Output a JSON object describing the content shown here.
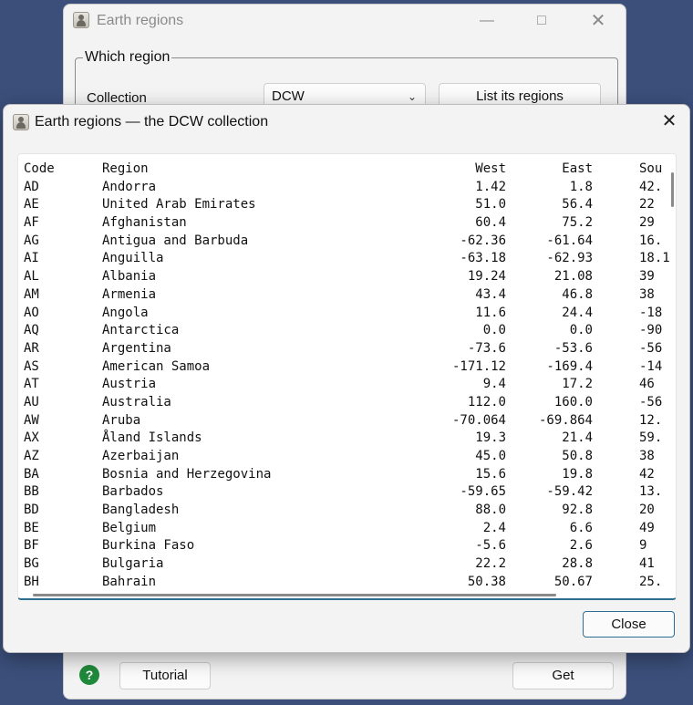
{
  "background_window": {
    "title": "Earth regions",
    "group_title": "Which region",
    "collection_label": "Collection",
    "collection_value": "DCW",
    "list_button": "List its regions",
    "help_icon": "?",
    "tutorial_button": "Tutorial",
    "get_button": "Get"
  },
  "dialog": {
    "title": "Earth regions — the DCW collection",
    "close_button": "Close",
    "columns": {
      "code": "Code",
      "region": "Region",
      "west": "West",
      "east": "East",
      "south": "Sou"
    },
    "rows": [
      {
        "code": "AD",
        "region": "Andorra",
        "west": "1.42",
        "east": "1.8",
        "south": "42."
      },
      {
        "code": "AE",
        "region": "United Arab Emirates",
        "west": "51.0",
        "east": "56.4",
        "south": "22"
      },
      {
        "code": "AF",
        "region": "Afghanistan",
        "west": "60.4",
        "east": "75.2",
        "south": "29"
      },
      {
        "code": "AG",
        "region": "Antigua and Barbuda",
        "west": "-62.36",
        "east": "-61.64",
        "south": "16."
      },
      {
        "code": "AI",
        "region": "Anguilla",
        "west": "-63.18",
        "east": "-62.93",
        "south": "18.1"
      },
      {
        "code": "AL",
        "region": "Albania",
        "west": "19.24",
        "east": "21.08",
        "south": "39"
      },
      {
        "code": "AM",
        "region": "Armenia",
        "west": "43.4",
        "east": "46.8",
        "south": "38"
      },
      {
        "code": "AO",
        "region": "Angola",
        "west": "11.6",
        "east": "24.4",
        "south": "-18"
      },
      {
        "code": "AQ",
        "region": "Antarctica",
        "west": "0.0",
        "east": "0.0",
        "south": "-90"
      },
      {
        "code": "AR",
        "region": "Argentina",
        "west": "-73.6",
        "east": "-53.6",
        "south": "-56"
      },
      {
        "code": "AS",
        "region": "American Samoa",
        "west": "-171.12",
        "east": "-169.4",
        "south": "-14"
      },
      {
        "code": "AT",
        "region": "Austria",
        "west": "9.4",
        "east": "17.2",
        "south": "46"
      },
      {
        "code": "AU",
        "region": "Australia",
        "west": "112.0",
        "east": "160.0",
        "south": "-56"
      },
      {
        "code": "AW",
        "region": "Aruba",
        "west": "-70.064",
        "east": "-69.864",
        "south": "12."
      },
      {
        "code": "AX",
        "region": "Åland Islands",
        "west": "19.3",
        "east": "21.4",
        "south": "59."
      },
      {
        "code": "AZ",
        "region": "Azerbaijan",
        "west": "45.0",
        "east": "50.8",
        "south": "38"
      },
      {
        "code": "BA",
        "region": "Bosnia and Herzegovina",
        "west": "15.6",
        "east": "19.8",
        "south": "42"
      },
      {
        "code": "BB",
        "region": "Barbados",
        "west": "-59.65",
        "east": "-59.42",
        "south": "13."
      },
      {
        "code": "BD",
        "region": "Bangladesh",
        "west": "88.0",
        "east": "92.8",
        "south": "20"
      },
      {
        "code": "BE",
        "region": "Belgium",
        "west": "2.4",
        "east": "6.6",
        "south": "49"
      },
      {
        "code": "BF",
        "region": "Burkina Faso",
        "west": "-5.6",
        "east": "2.6",
        "south": "9"
      },
      {
        "code": "BG",
        "region": "Bulgaria",
        "west": "22.2",
        "east": "28.8",
        "south": "41"
      },
      {
        "code": "BH",
        "region": "Bahrain",
        "west": "50.38",
        "east": "50.67",
        "south": "25."
      }
    ]
  }
}
